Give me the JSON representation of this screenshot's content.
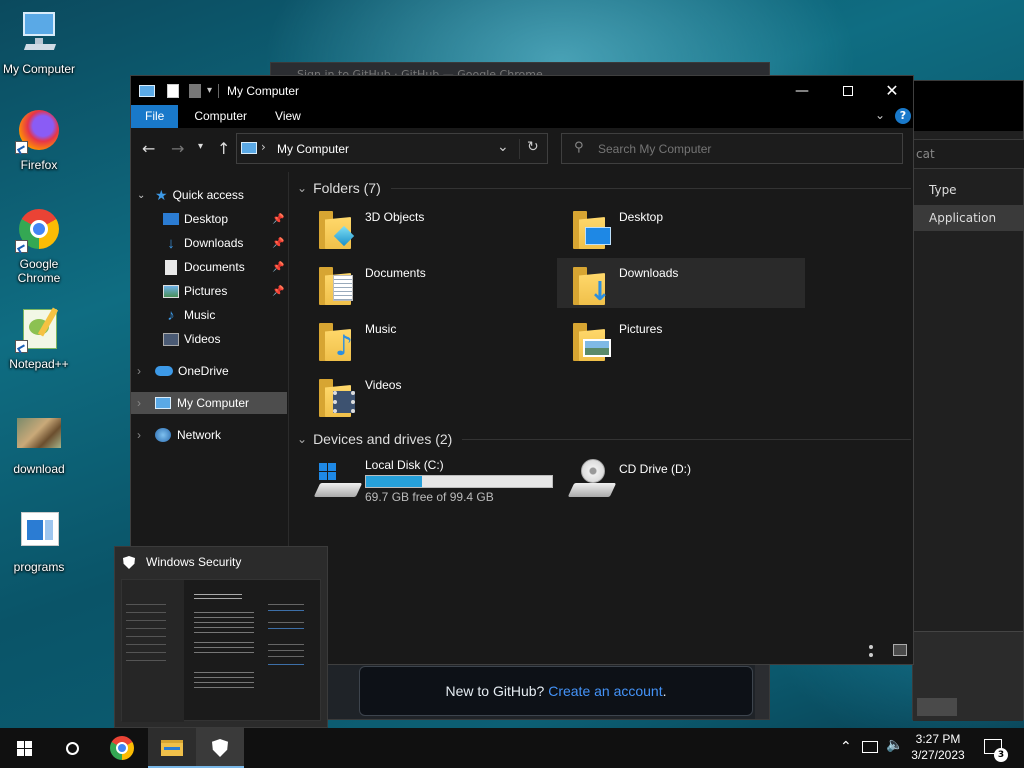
{
  "desktop": {
    "icons": [
      {
        "label": "My Computer",
        "icon": "computer-icon"
      },
      {
        "label": "Firefox",
        "icon": "firefox-icon"
      },
      {
        "label": "Google Chrome",
        "icon": "chrome-icon"
      },
      {
        "label": "Notepad++",
        "icon": "notepadpp-icon"
      },
      {
        "label": "download",
        "icon": "image-icon"
      },
      {
        "label": "programs",
        "icon": "programs-icon"
      }
    ]
  },
  "bg_windows": {
    "github_title": "Sign in to GitHub · GitHub — Google Chrome",
    "github_banner": "New to GitHub?",
    "github_link": "Create an account",
    "github_period": ".",
    "right_search": "cat",
    "right_col_header": "Type",
    "right_col_value": "Application"
  },
  "explorer": {
    "title": "My Computer",
    "tabs": [
      "File",
      "Computer",
      "View"
    ],
    "address": "My Computer",
    "search_placeholder": "Search My Computer",
    "nav": {
      "quick_access": "Quick access",
      "quick_items": [
        "Desktop",
        "Downloads",
        "Documents",
        "Pictures",
        "Music",
        "Videos"
      ],
      "onedrive": "OneDrive",
      "mycomputer": "My Computer",
      "network": "Network"
    },
    "folders_header": "Folders (7)",
    "folders": [
      "3D Objects",
      "Desktop",
      "Documents",
      "Downloads",
      "Music",
      "Pictures",
      "Videos"
    ],
    "drives_header": "Devices and drives (2)",
    "drives": [
      {
        "name": "Local Disk (C:)",
        "free": "69.7 GB free of 99.4 GB",
        "used_fraction": 0.3
      },
      {
        "name": "CD Drive (D:)"
      }
    ]
  },
  "flyout": {
    "title": "Windows Security"
  },
  "taskbar": {
    "time": "3:27 PM",
    "date": "3/27/2023",
    "notification_count": "3"
  },
  "colors": {
    "accent": "#1979ca",
    "folder": "#f0c04a",
    "taskbar": "#101010",
    "window_bg": "#191919"
  }
}
